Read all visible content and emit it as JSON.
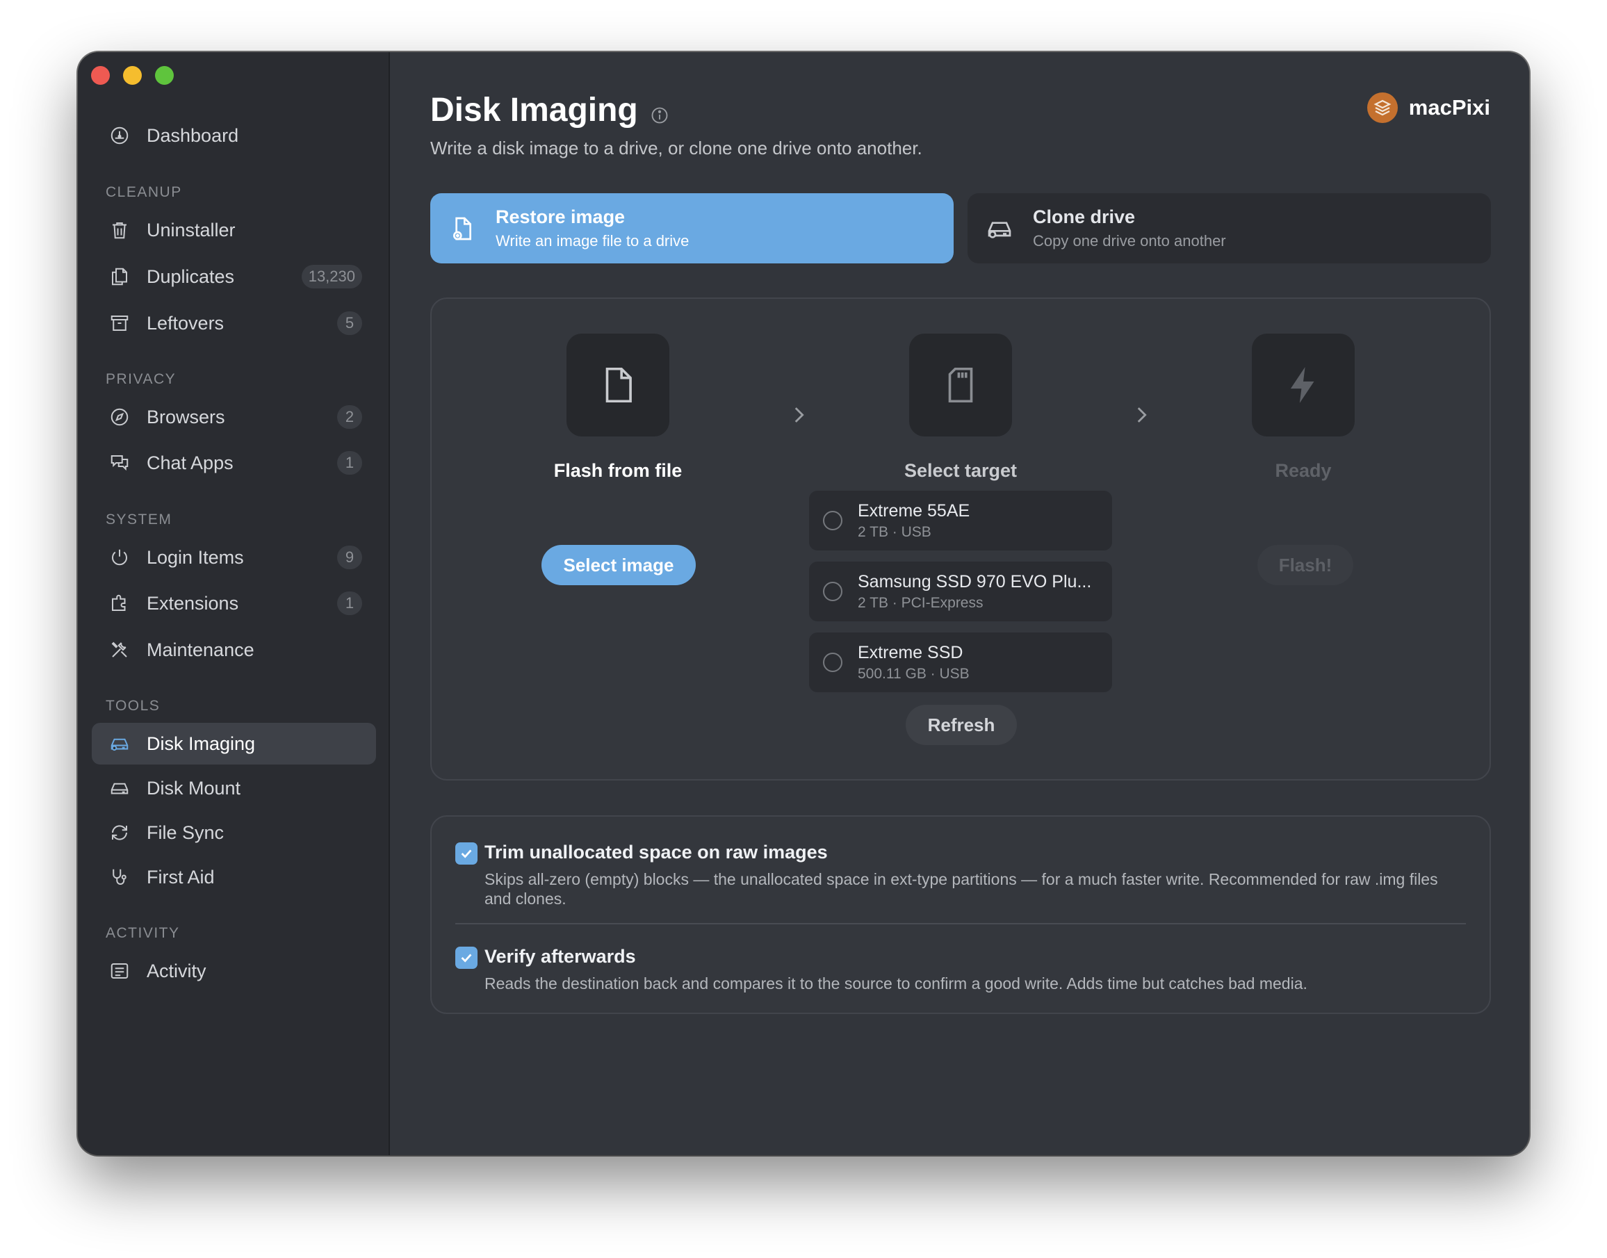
{
  "sidebar": {
    "dashboard": {
      "label": "Dashboard",
      "icon": "dashboard-gauge-icon"
    },
    "sections": {
      "cleanup": "CLEANUP",
      "privacy": "PRIVACY",
      "system": "SYSTEM",
      "tools": "TOOLS",
      "activity": "ACTIVITY"
    },
    "items": {
      "uninstaller": {
        "label": "Uninstaller",
        "icon": "trash-icon"
      },
      "duplicates": {
        "label": "Duplicates",
        "badge": "13,230",
        "icon": "duplicate-files-icon"
      },
      "leftovers": {
        "label": "Leftovers",
        "badge": "5",
        "icon": "archive-box-icon"
      },
      "browsers": {
        "label": "Browsers",
        "badge": "2",
        "icon": "compass-icon"
      },
      "chat_apps": {
        "label": "Chat Apps",
        "badge": "1",
        "icon": "chat-bubbles-icon"
      },
      "login_items": {
        "label": "Login Items",
        "badge": "9",
        "icon": "power-icon"
      },
      "extensions": {
        "label": "Extensions",
        "badge": "1",
        "icon": "puzzle-extension-icon"
      },
      "maintenance": {
        "label": "Maintenance",
        "icon": "tools-icon"
      },
      "disk_imaging": {
        "label": "Disk Imaging",
        "icon": "disk-drive-icon",
        "active": true
      },
      "disk_mount": {
        "label": "Disk Mount",
        "icon": "disk-mount-icon"
      },
      "file_sync": {
        "label": "File Sync",
        "icon": "sync-arrows-icon"
      },
      "first_aid": {
        "label": "First Aid",
        "icon": "stethoscope-icon"
      },
      "activity": {
        "label": "Activity",
        "icon": "activity-list-icon"
      }
    }
  },
  "header": {
    "title": "Disk Imaging",
    "subtitle": "Write a disk image to a drive, or clone one drive onto another.",
    "brand": "macPixi"
  },
  "modes": {
    "restore": {
      "title": "Restore image",
      "description": "Write an image file to a drive",
      "selected": true
    },
    "clone": {
      "title": "Clone drive",
      "description": "Copy one drive onto another",
      "selected": false
    }
  },
  "steps": {
    "source": {
      "label": "Flash from file",
      "button": "Select image"
    },
    "target": {
      "label": "Select target",
      "button": "Refresh"
    },
    "ready": {
      "label": "Ready",
      "button": "Flash!"
    }
  },
  "drives": [
    {
      "name": "Extreme 55AE",
      "meta": "2 TB · USB"
    },
    {
      "name": "Samsung SSD 970 EVO Plu...",
      "meta": "2 TB · PCI-Express"
    },
    {
      "name": "Extreme SSD",
      "meta": "500.11 GB · USB"
    }
  ],
  "options": {
    "trim": {
      "title": "Trim unallocated space on raw images",
      "description": "Skips all-zero (empty) blocks — the unallocated space in ext-type partitions — for a much faster write. Recommended for raw .img files and clones.",
      "checked": true
    },
    "verify": {
      "title": "Verify afterwards",
      "description": "Reads the destination back and compares it to the source to confirm a good write. Adds time but catches bad media.",
      "checked": true
    }
  },
  "colors": {
    "accent": "#6aa9e2",
    "window_bg": "#32353b",
    "sidebar_bg": "#2a2c31",
    "brand_logo": "#c4702e"
  }
}
